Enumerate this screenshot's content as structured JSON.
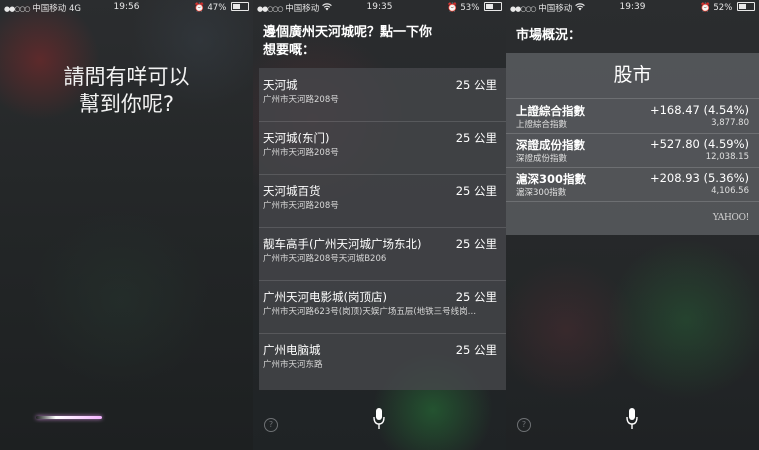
{
  "screen1": {
    "status": {
      "carrier": "中国移动",
      "network": "4G",
      "time": "19:56",
      "battery": "47%",
      "battery_level": 0.47
    },
    "prompt_line1": "請問有咩可以",
    "prompt_line2": "幫到你呢?"
  },
  "screen2": {
    "status": {
      "carrier": "中国移动",
      "time": "19:35",
      "battery": "53%",
      "battery_level": 0.53
    },
    "question_line1": "邊個廣州天河城呢？點一下你",
    "question_line2": "想要嘅：",
    "results": [
      {
        "name": "天河城",
        "address": "广州市天河路208号",
        "distance": "25 公里"
      },
      {
        "name": "天河城(东门)",
        "address": "广州市天河路208号",
        "distance": "25 公里"
      },
      {
        "name": "天河城百货",
        "address": "广州市天河路208号",
        "distance": "25 公里"
      },
      {
        "name": "靓车高手(广州天河城广场东北)",
        "address": "广州市天河路208号天河城B206",
        "distance": "25 公里"
      },
      {
        "name": "广州天河电影城(岗顶店)",
        "address": "广州市天河路623号(岗顶)天娱广场五层(地铁三号线岗…",
        "distance": "25 公里"
      },
      {
        "name": "广州电脑城",
        "address": "广州市天河东路",
        "distance": "25 公里"
      }
    ],
    "help_glyph": "?"
  },
  "screen3": {
    "status": {
      "carrier": "中国移动",
      "time": "19:39",
      "battery": "52%",
      "battery_level": 0.52
    },
    "title": "市場概況：",
    "card_title": "股市",
    "stocks": [
      {
        "name": "上證綜合指數",
        "sub": "上證綜合指數",
        "change": "+168.47 (4.54%)",
        "price": "3,877.80"
      },
      {
        "name": "深證成份指數",
        "sub": "深證成份指數",
        "change": "+527.80 (4.59%)",
        "price": "12,038.15"
      },
      {
        "name": "滬深300指數",
        "sub": "滬深300指數",
        "change": "+208.93 (5.36%)",
        "price": "4,106.56"
      }
    ],
    "source": "YAHOO!",
    "help_glyph": "?"
  }
}
